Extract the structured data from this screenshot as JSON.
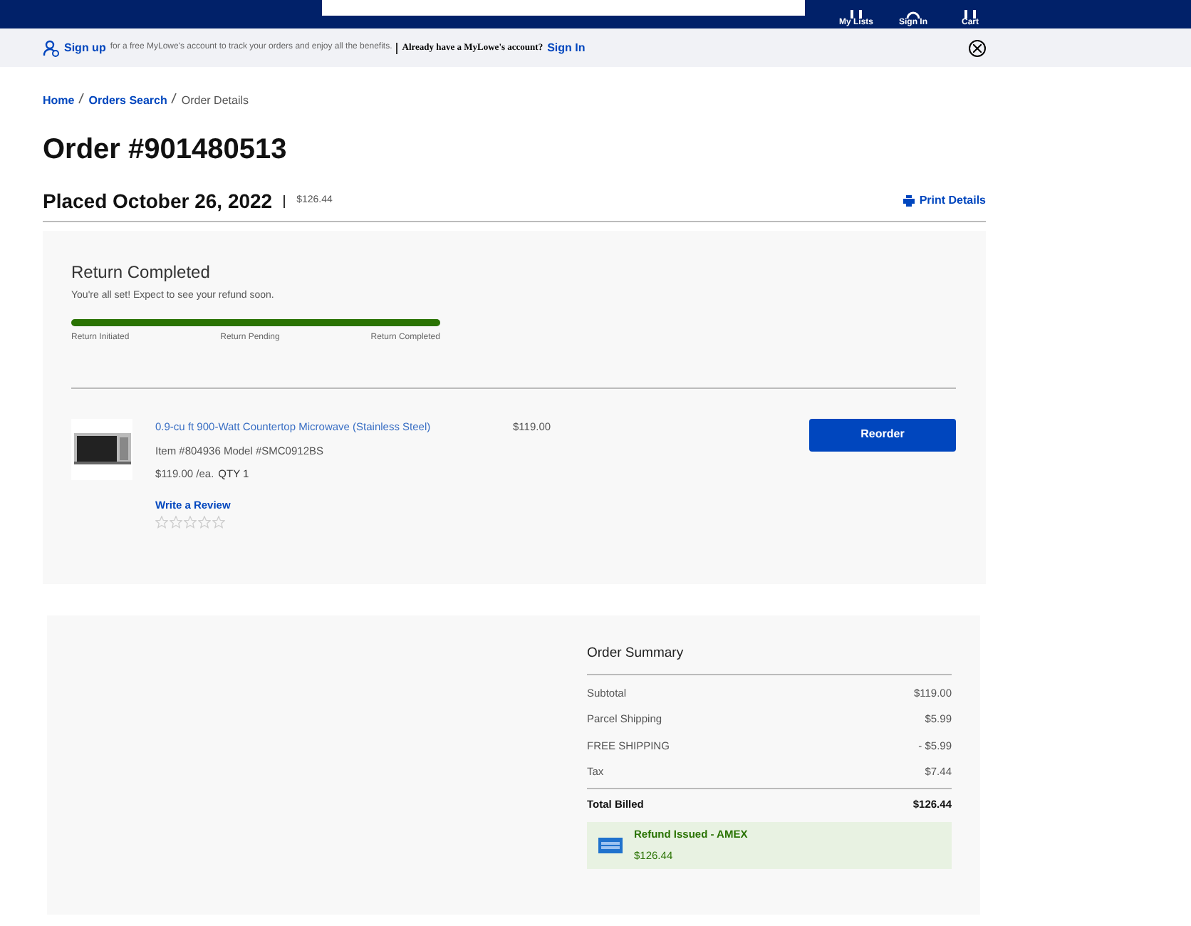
{
  "header": {
    "nav": [
      "My Lists",
      "Sign In",
      "Cart"
    ]
  },
  "banner": {
    "link": "Sign up",
    "text": "for a free MyLowe's account to track your orders and enjoy all the benefits.",
    "question": "Already have a MyLowe's account?",
    "signin": "Sign In"
  },
  "breadcrumb": [
    "Home",
    "Orders Search",
    "Order Details"
  ],
  "title": "Order #901480513",
  "placed": "Placed October 26, 2022",
  "total": "$126.44",
  "print": "Print Details",
  "status": {
    "title": "Return Completed",
    "message": "You're all set! Expect to see your refund soon.",
    "level": 1,
    "steps": [
      "Return Initiated",
      "Return Pending",
      "Return Completed"
    ]
  },
  "item": {
    "name": "0.9-cu ft 900-Watt Countertop Microwave (Stainless Steel)",
    "ids": "Item #804936 Model #SMC0912BS",
    "unit": "$119.00 /ea.",
    "qty": "QTY 1",
    "price": "$119.00",
    "review": "Write a Review",
    "stars": 0,
    "button": "Reorder"
  },
  "summary": {
    "title": "Order Summary",
    "rows": [
      {
        "label": "Subtotal",
        "value": "$119.00"
      },
      {
        "label": "Parcel Shipping",
        "value": "$5.99"
      },
      {
        "label": "FREE SHIPPING",
        "value": "- $5.99"
      },
      {
        "label": "Tax",
        "value": "$7.44"
      }
    ],
    "total_label": "Total Billed",
    "total_value": "$126.44",
    "refund": {
      "title": "Refund Issued - AMEX",
      "amount": "$126.44"
    }
  }
}
